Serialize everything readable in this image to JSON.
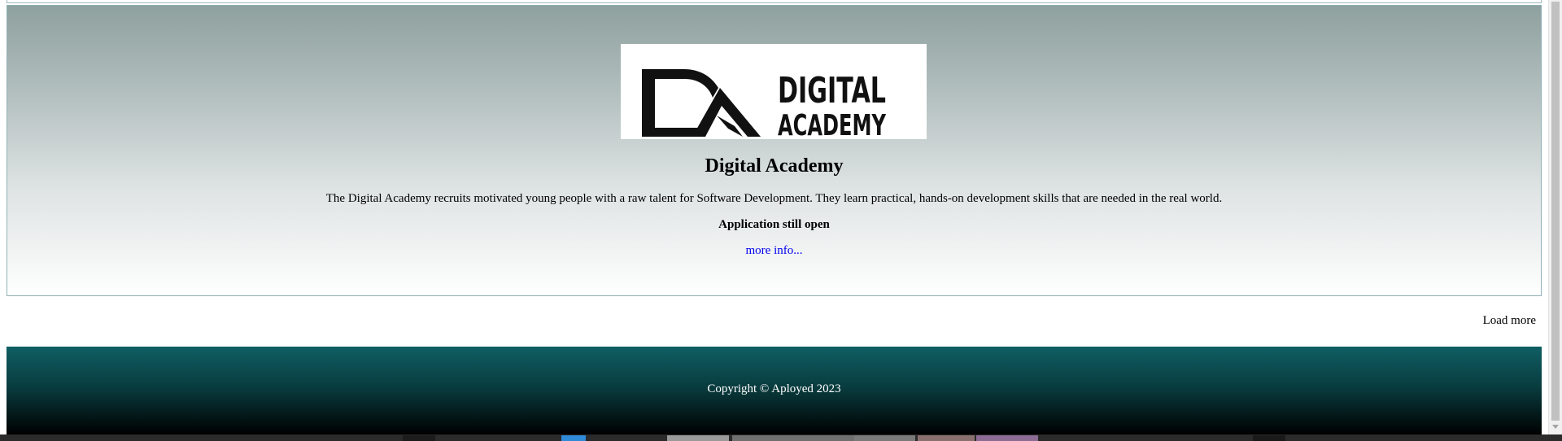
{
  "card": {
    "logo_text_line1": "DIGITAL",
    "logo_text_line2": "ACADEMY",
    "title": "Digital Academy",
    "description": "The Digital Academy recruits motivated young people with a raw talent for Software Development. They learn practical, hands-on development skills that are needed in the real world.",
    "status": "Application still open",
    "link_label": "more info..."
  },
  "load_more_label": "Load more",
  "footer": {
    "copyright": "Copyright © Aployed 2023"
  },
  "colors": {
    "footer_top": "#0f5e63",
    "footer_bottom": "#000000",
    "card_top": "#8ea09f",
    "card_bottom": "#ffffff",
    "link": "#0000ee"
  }
}
